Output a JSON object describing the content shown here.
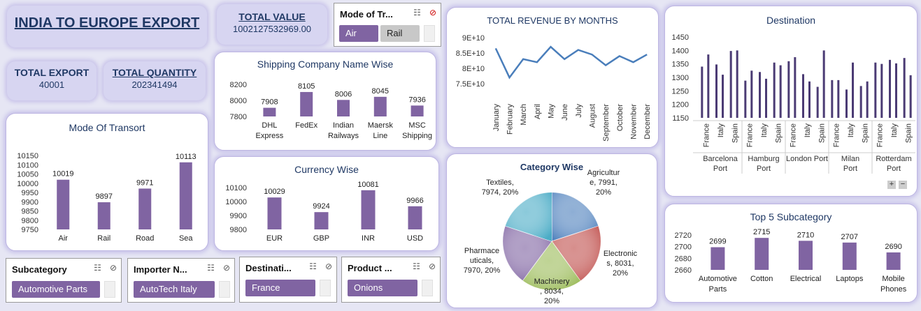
{
  "title": "INDIA TO EUROPE EXPORT",
  "total_value": {
    "label": "TOTAL VALUE",
    "value": "1002127532969.00"
  },
  "total_export": {
    "label": "TOTAL EXPORT",
    "value": "40001"
  },
  "total_quantity": {
    "label": "TOTAL QUANTITY",
    "value": "202341494"
  },
  "slicers": {
    "mode": {
      "title": "Mode of Tr...",
      "items": [
        "Air",
        "Rail"
      ]
    },
    "subcategory": {
      "title": "Subcategory",
      "selected": "Automotive Parts"
    },
    "importer": {
      "title": "Importer N...",
      "selected": "AutoTech Italy"
    },
    "destination": {
      "title": "Destinati...",
      "selected": "France"
    },
    "product": {
      "title": "Product ...",
      "selected": "Onions"
    }
  },
  "icons": {
    "multi_select": "multi-select-icon",
    "clear_filter": "clear-filter-icon"
  },
  "colors": {
    "bar": "#8064a2",
    "line": "#4a7ebb",
    "title": "#1f3864"
  },
  "chart_data": [
    {
      "id": "mode",
      "type": "bar",
      "title": "Mode Of Transort",
      "categories": [
        "Air",
        "Rail",
        "Road",
        "Sea"
      ],
      "values": [
        10019,
        9897,
        9971,
        10113
      ],
      "ylim": [
        9750,
        10150
      ],
      "yticks": [
        "10150",
        "10100",
        "10050",
        "10000",
        "9950",
        "9900",
        "9850",
        "9800",
        "9750"
      ]
    },
    {
      "id": "shipping",
      "type": "bar",
      "title": "Shipping Company Name Wise",
      "categories": [
        "DHL Express",
        "FedEx",
        "Indian Railways",
        "Maersk Line",
        "MSC Shipping"
      ],
      "values": [
        7908,
        8105,
        8006,
        8045,
        7936
      ],
      "ylim": [
        7800,
        8200
      ],
      "yticks": [
        "8200",
        "8000",
        "7800"
      ]
    },
    {
      "id": "currency",
      "type": "bar",
      "title": "Currency Wise",
      "categories": [
        "EUR",
        "GBP",
        "INR",
        "USD"
      ],
      "values": [
        10029,
        9924,
        10081,
        9966
      ],
      "ylim": [
        9800,
        10100
      ],
      "yticks": [
        "10100",
        "10000",
        "9900",
        "9800"
      ]
    },
    {
      "id": "revenue",
      "type": "line",
      "title": "TOTAL REVENUE BY MONTHS",
      "categories": [
        "January",
        "February",
        "March",
        "April",
        "May",
        "June",
        "July",
        "August",
        "September",
        "October",
        "November",
        "December"
      ],
      "values": [
        86500000000.0,
        77000000000.0,
        83000000000.0,
        82000000000.0,
        87000000000.0,
        83000000000.0,
        86000000000.0,
        84500000000.0,
        81000000000.0,
        84000000000.0,
        82000000000.0,
        84500000000.0
      ],
      "ylim": [
        70000000000.0,
        90000000000.0
      ],
      "yticks": [
        "9E+10",
        "8.5E+10",
        "8E+10",
        "7.5E+10",
        "7E+10"
      ]
    },
    {
      "id": "destination",
      "type": "bar",
      "title": "Destination",
      "groups": [
        {
          "name": "Barcelona Port",
          "categories": [
            "France",
            "Italy",
            "Spain"
          ],
          "values": [
            [
              1340,
              1385
            ],
            [
              1348,
              1310
            ],
            [
              1398,
              1400
            ]
          ]
        },
        {
          "name": "Hamburg Port",
          "categories": [
            "France",
            "Italy",
            "Spain"
          ],
          "values": [
            [
              1288,
              1325
            ],
            [
              1320,
              1295
            ],
            [
              1355,
              1345
            ]
          ]
        },
        {
          "name": "London Port",
          "categories": [
            "France",
            "Italy",
            "Spain"
          ],
          "values": [
            [
              1360,
              1375
            ],
            [
              1312,
              1285
            ],
            [
              1265,
              1400
            ]
          ]
        },
        {
          "name": "Milan Port",
          "categories": [
            "France",
            "Italy",
            "Spain"
          ],
          "values": [
            [
              1290,
              1290
            ],
            [
              1255,
              1355
            ],
            [
              1268,
              1285
            ]
          ]
        },
        {
          "name": "Rotterdam Port",
          "categories": [
            "France",
            "Italy",
            "Spain"
          ],
          "values": [
            [
              1355,
              1350
            ],
            [
              1365,
              1352
            ],
            [
              1372,
              1308
            ]
          ]
        }
      ],
      "ylim": [
        1150,
        1450
      ],
      "yticks": [
        "1450",
        "1400",
        "1350",
        "1300",
        "1250",
        "1200",
        "1150"
      ]
    },
    {
      "id": "category",
      "type": "pie",
      "title": "Category Wise",
      "slices": [
        {
          "label": "Agricultur\ne, 7991,\n20%",
          "value": 7991,
          "color": "#4f81bd"
        },
        {
          "label": "Electronic\ns, 8031,\n20%",
          "value": 8031,
          "color": "#c0504d"
        },
        {
          "label": "Machinery\n, 8034,\n20%",
          "value": 8034,
          "color": "#9bbb59"
        },
        {
          "label": "Pharmace\nuticals,\n7970, 20%",
          "value": 7970,
          "color": "#8064a2"
        },
        {
          "label": "Textiles,\n7974, 20%",
          "value": 7974,
          "color": "#4bacc6"
        }
      ]
    },
    {
      "id": "subcategory",
      "type": "bar",
      "title": "Top 5 Subcategory",
      "categories": [
        "Automotive Parts",
        "Cotton",
        "Electrical",
        "Laptops",
        "Mobile Phones"
      ],
      "values": [
        2699,
        2715,
        2710,
        2707,
        2690
      ],
      "ylim": [
        2660,
        2720
      ],
      "yticks": [
        "2720",
        "2700",
        "2680",
        "2660"
      ]
    }
  ]
}
